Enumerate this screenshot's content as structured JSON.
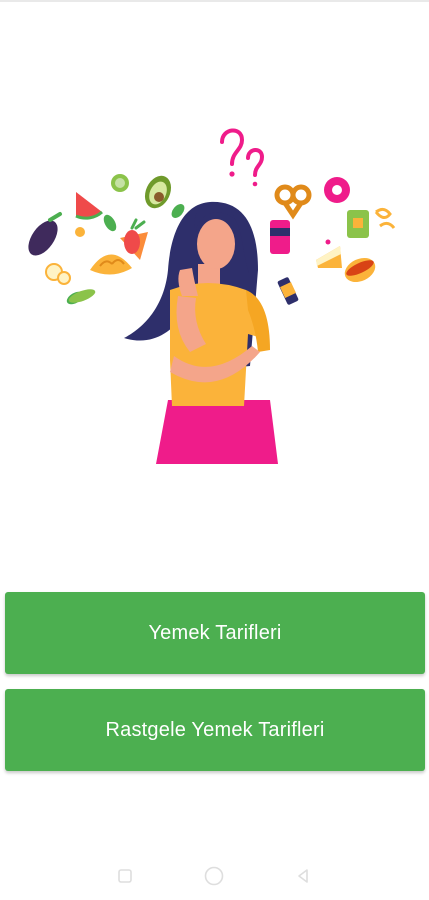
{
  "hero": {
    "illustration": "woman-thinking-about-food-icon",
    "colors": {
      "shirt": "#fbb33a",
      "skirt": "#ef1c8a",
      "hair": "#2e2f6b",
      "skin": "#f4a58a",
      "question_marks": "#ef1c8a"
    }
  },
  "buttons": {
    "recipes_label": "Yemek Tarifleri",
    "random_label": "Rastgele Yemek Tarifleri",
    "color": "#4caf50"
  },
  "nav": {
    "recents_icon": "square-icon",
    "home_icon": "circle-icon",
    "back_icon": "triangle-back-icon"
  }
}
